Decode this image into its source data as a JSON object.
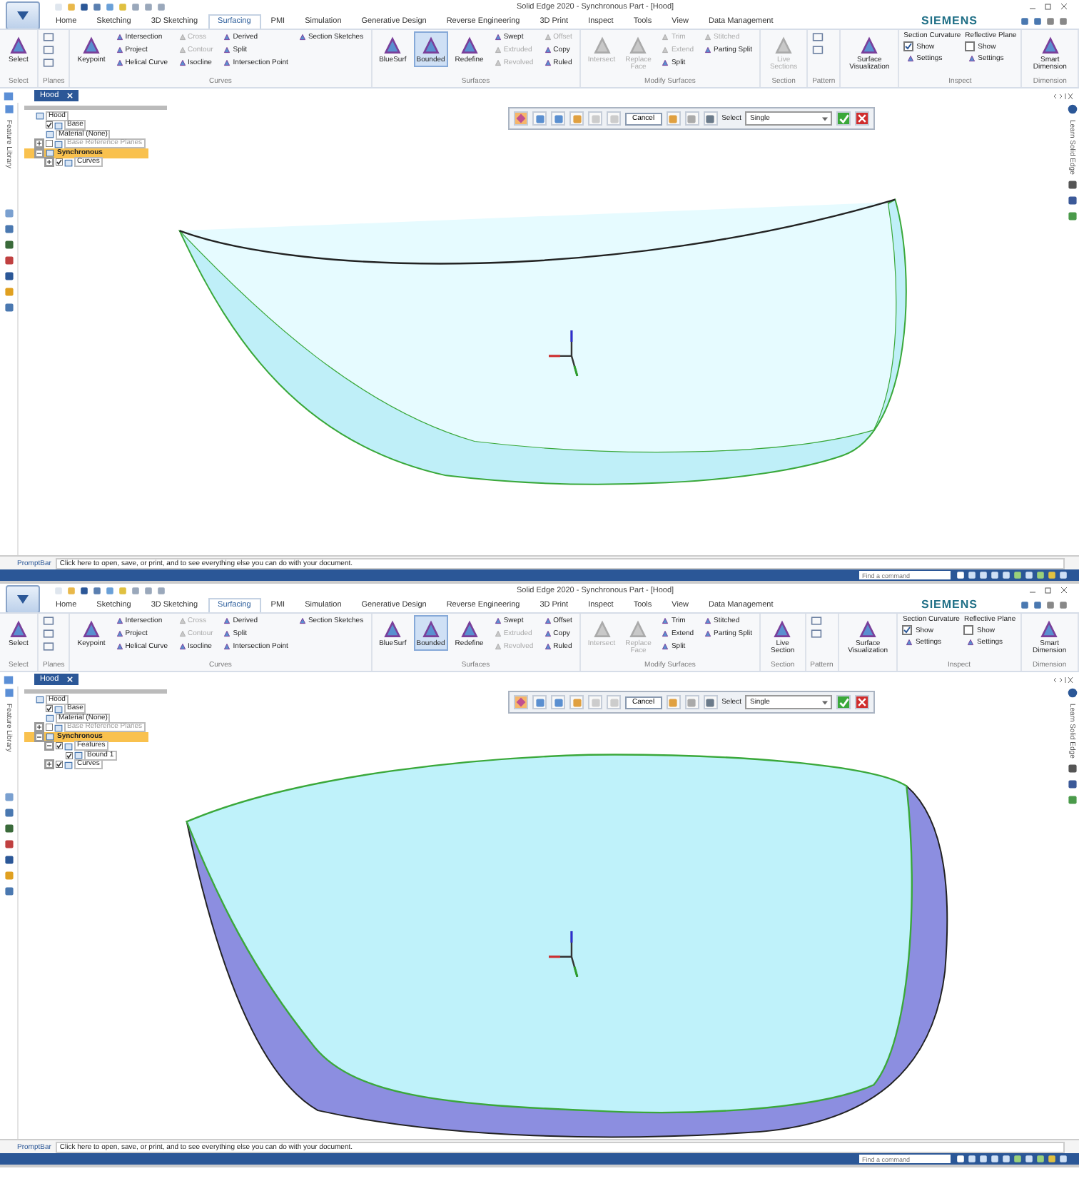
{
  "screens": [
    {
      "window": {
        "title": "Solid Edge 2020 - Synchronous Part - [Hood]",
        "brand": "SIEMENS"
      },
      "ribbon_tabs": [
        {
          "label": "Home",
          "selected": false
        },
        {
          "label": "Sketching",
          "selected": false
        },
        {
          "label": "3D Sketching",
          "selected": false
        },
        {
          "label": "Surfacing",
          "selected": true
        },
        {
          "label": "PMI",
          "selected": false
        },
        {
          "label": "Simulation",
          "selected": false
        },
        {
          "label": "Generative Design",
          "selected": false
        },
        {
          "label": "Reverse Engineering",
          "selected": false
        },
        {
          "label": "3D Print",
          "selected": false
        },
        {
          "label": "Inspect",
          "selected": false
        },
        {
          "label": "Tools",
          "selected": false
        },
        {
          "label": "View",
          "selected": false
        },
        {
          "label": "Data Management",
          "selected": false
        }
      ],
      "ribbon_groups": [
        {
          "label": "Select",
          "columns": [
            [
              {
                "kind": "large",
                "label": "Select",
                "disabled": false,
                "selected": false
              }
            ]
          ]
        },
        {
          "label": "Planes",
          "columns": [
            [
              {
                "kind": "icon",
                "disabled": false,
                "selected": false
              },
              {
                "kind": "icon",
                "disabled": false,
                "selected": false
              },
              {
                "kind": "icon",
                "disabled": false,
                "selected": false
              }
            ]
          ]
        },
        {
          "label": "Curves",
          "columns": [
            [
              {
                "kind": "large",
                "label": "Keypoint",
                "disabled": false,
                "selected": false
              }
            ],
            [
              {
                "kind": "small",
                "label": "Intersection",
                "disabled": false,
                "selected": false
              },
              {
                "kind": "small",
                "label": "Project",
                "disabled": false,
                "selected": false
              },
              {
                "kind": "small",
                "label": "Helical Curve",
                "disabled": false,
                "selected": false
              }
            ],
            [
              {
                "kind": "small",
                "label": "Cross",
                "disabled": true,
                "selected": false
              },
              {
                "kind": "small",
                "label": "Contour",
                "disabled": true,
                "selected": false
              },
              {
                "kind": "small",
                "label": "Isocline",
                "disabled": false,
                "selected": false
              }
            ],
            [
              {
                "kind": "small",
                "label": "Derived",
                "disabled": false,
                "selected": false
              },
              {
                "kind": "small",
                "label": "Split",
                "disabled": false,
                "selected": false
              },
              {
                "kind": "small",
                "label": "Intersection Point",
                "disabled": false,
                "selected": false
              }
            ],
            [
              {
                "kind": "small",
                "label": "Section Sketches",
                "disabled": false,
                "selected": false
              }
            ]
          ]
        },
        {
          "label": "Surfaces",
          "columns": [
            [
              {
                "kind": "large",
                "label": "BlueSurf",
                "disabled": false,
                "selected": false
              }
            ],
            [
              {
                "kind": "large",
                "label": "Bounded",
                "disabled": false,
                "selected": true
              }
            ],
            [
              {
                "kind": "large",
                "label": "Redefine",
                "disabled": false,
                "selected": false
              }
            ],
            [
              {
                "kind": "small",
                "label": "Swept",
                "disabled": false,
                "selected": false
              },
              {
                "kind": "small",
                "label": "Extruded",
                "disabled": true,
                "selected": false
              },
              {
                "kind": "small",
                "label": "Revolved",
                "disabled": true,
                "selected": false
              }
            ],
            [
              {
                "kind": "small",
                "label": "Offset",
                "disabled": true,
                "selected": false
              },
              {
                "kind": "small",
                "label": "Copy",
                "disabled": false,
                "selected": false
              },
              {
                "kind": "small",
                "label": "Ruled",
                "disabled": false,
                "selected": false
              }
            ]
          ]
        },
        {
          "label": "Modify Surfaces",
          "columns": [
            [
              {
                "kind": "large",
                "label": "Intersect",
                "disabled": true,
                "selected": false
              }
            ],
            [
              {
                "kind": "large",
                "label": "Replace Face",
                "disabled": true,
                "selected": false
              }
            ],
            [
              {
                "kind": "small",
                "label": "Trim",
                "disabled": true,
                "selected": false
              },
              {
                "kind": "small",
                "label": "Extend",
                "disabled": true,
                "selected": false
              },
              {
                "kind": "small",
                "label": "Split",
                "disabled": false,
                "selected": false
              }
            ],
            [
              {
                "kind": "small",
                "label": "Stitched",
                "disabled": true,
                "selected": false
              },
              {
                "kind": "small",
                "label": "Parting Split",
                "disabled": false,
                "selected": false
              }
            ]
          ]
        },
        {
          "label": "Section",
          "columns": [
            [
              {
                "kind": "large",
                "label": "Live Sections",
                "disabled": true,
                "selected": false
              }
            ]
          ]
        },
        {
          "label": "Pattern",
          "columns": [
            [
              {
                "kind": "icon",
                "disabled": false,
                "selected": false
              },
              {
                "kind": "icon",
                "disabled": false,
                "selected": false
              }
            ]
          ]
        },
        {
          "columns": [
            [
              {
                "kind": "large",
                "label": "Surface Visualization",
                "disabled": false,
                "selected": false
              }
            ]
          ]
        },
        {
          "label": "Inspect",
          "columns": [
            [
              {
                "kind": "text",
                "label": "Section Curvature",
                "disabled": false,
                "selected": false
              },
              {
                "kind": "checkbox",
                "label": "Show",
                "checked": true,
                "disabled": false,
                "selected": false
              },
              {
                "kind": "small",
                "label": "Settings",
                "disabled": false,
                "selected": false
              }
            ],
            [
              {
                "kind": "text",
                "label": "Reflective Plane",
                "disabled": false,
                "selected": false
              },
              {
                "kind": "checkbox",
                "label": "Show",
                "checked": false,
                "disabled": false,
                "selected": false
              },
              {
                "kind": "small",
                "label": "Settings",
                "disabled": false,
                "selected": false
              }
            ]
          ]
        },
        {
          "label": "Dimension",
          "columns": [
            [
              {
                "kind": "large",
                "label": "Smart Dimension",
                "disabled": false,
                "selected": false
              }
            ]
          ]
        }
      ],
      "document_tab": "Hood",
      "side_tab": "Feature Library",
      "right_side_tab": "Learn Solid Edge",
      "tree": [
        {
          "label": "Hood",
          "children": [
            {
              "label": "Base",
              "checked": true
            },
            {
              "label": "Material (None)"
            },
            {
              "label": "Base Reference Planes",
              "checked": false,
              "expanded": false,
              "disabled": true
            },
            {
              "label": "Synchronous",
              "expanded": true,
              "selected": true,
              "children": [
                {
                  "label": "Curves",
                  "checked": true,
                  "expanded": false
                }
              ]
            }
          ]
        }
      ],
      "command_bar": {
        "cancel": "Cancel",
        "select_label": "Select",
        "select_value": "Single"
      },
      "model": {
        "kind": "open_edge"
      },
      "prompt_bar": {
        "label": "PromptBar",
        "message": "Click here to open, save, or print, and to see everything else you can do with your document."
      },
      "status_bar": {
        "placeholder": "Find a command"
      }
    },
    {
      "window": {
        "title": "Solid Edge 2020 - Synchronous Part - [Hood]",
        "brand": "SIEMENS"
      },
      "ribbon_tabs": [
        {
          "label": "Home",
          "selected": false
        },
        {
          "label": "Sketching",
          "selected": false
        },
        {
          "label": "3D Sketching",
          "selected": false
        },
        {
          "label": "Surfacing",
          "selected": true
        },
        {
          "label": "PMI",
          "selected": false
        },
        {
          "label": "Simulation",
          "selected": false
        },
        {
          "label": "Generative Design",
          "selected": false
        },
        {
          "label": "Reverse Engineering",
          "selected": false
        },
        {
          "label": "3D Print",
          "selected": false
        },
        {
          "label": "Inspect",
          "selected": false
        },
        {
          "label": "Tools",
          "selected": false
        },
        {
          "label": "View",
          "selected": false
        },
        {
          "label": "Data Management",
          "selected": false
        }
      ],
      "ribbon_groups": [
        {
          "label": "Select",
          "columns": [
            [
              {
                "kind": "large",
                "label": "Select",
                "disabled": false,
                "selected": false
              }
            ]
          ]
        },
        {
          "label": "Planes",
          "columns": [
            [
              {
                "kind": "icon",
                "disabled": false,
                "selected": false
              },
              {
                "kind": "icon",
                "disabled": false,
                "selected": false
              },
              {
                "kind": "icon",
                "disabled": false,
                "selected": false
              }
            ]
          ]
        },
        {
          "label": "Curves",
          "columns": [
            [
              {
                "kind": "large",
                "label": "Keypoint",
                "disabled": false,
                "selected": false
              }
            ],
            [
              {
                "kind": "small",
                "label": "Intersection",
                "disabled": false,
                "selected": false
              },
              {
                "kind": "small",
                "label": "Project",
                "disabled": false,
                "selected": false
              },
              {
                "kind": "small",
                "label": "Helical Curve",
                "disabled": false,
                "selected": false
              }
            ],
            [
              {
                "kind": "small",
                "label": "Cross",
                "disabled": true,
                "selected": false
              },
              {
                "kind": "small",
                "label": "Contour",
                "disabled": true,
                "selected": false
              },
              {
                "kind": "small",
                "label": "Isocline",
                "disabled": false,
                "selected": false
              }
            ],
            [
              {
                "kind": "small",
                "label": "Derived",
                "disabled": false,
                "selected": false
              },
              {
                "kind": "small",
                "label": "Split",
                "disabled": false,
                "selected": false
              },
              {
                "kind": "small",
                "label": "Intersection Point",
                "disabled": false,
                "selected": false
              }
            ],
            [
              {
                "kind": "small",
                "label": "Section Sketches",
                "disabled": false,
                "selected": false
              }
            ]
          ]
        },
        {
          "label": "Surfaces",
          "columns": [
            [
              {
                "kind": "large",
                "label": "BlueSurf",
                "disabled": false,
                "selected": false
              }
            ],
            [
              {
                "kind": "large",
                "label": "Bounded",
                "disabled": false,
                "selected": true
              }
            ],
            [
              {
                "kind": "large",
                "label": "Redefine",
                "disabled": false,
                "selected": false
              }
            ],
            [
              {
                "kind": "small",
                "label": "Swept",
                "disabled": false,
                "selected": false
              },
              {
                "kind": "small",
                "label": "Extruded",
                "disabled": true,
                "selected": false
              },
              {
                "kind": "small",
                "label": "Revolved",
                "disabled": true,
                "selected": false
              }
            ],
            [
              {
                "kind": "small",
                "label": "Offset",
                "disabled": false,
                "selected": false
              },
              {
                "kind": "small",
                "label": "Copy",
                "disabled": false,
                "selected": false
              },
              {
                "kind": "small",
                "label": "Ruled",
                "disabled": false,
                "selected": false
              }
            ]
          ]
        },
        {
          "label": "Modify Surfaces",
          "columns": [
            [
              {
                "kind": "large",
                "label": "Intersect",
                "disabled": true,
                "selected": false
              }
            ],
            [
              {
                "kind": "large",
                "label": "Replace Face",
                "disabled": true,
                "selected": false
              }
            ],
            [
              {
                "kind": "small",
                "label": "Trim",
                "disabled": false,
                "selected": false
              },
              {
                "kind": "small",
                "label": "Extend",
                "disabled": false,
                "selected": false
              },
              {
                "kind": "small",
                "label": "Split",
                "disabled": false,
                "selected": false
              }
            ],
            [
              {
                "kind": "small",
                "label": "Stitched",
                "disabled": false,
                "selected": false
              },
              {
                "kind": "small",
                "label": "Parting Split",
                "disabled": false,
                "selected": false
              }
            ]
          ]
        },
        {
          "label": "Section",
          "columns": [
            [
              {
                "kind": "large",
                "label": "Live Section",
                "disabled": false,
                "selected": false
              }
            ]
          ]
        },
        {
          "label": "Pattern",
          "columns": [
            [
              {
                "kind": "icon",
                "disabled": false,
                "selected": false
              },
              {
                "kind": "icon",
                "disabled": false,
                "selected": false
              }
            ]
          ]
        },
        {
          "columns": [
            [
              {
                "kind": "large",
                "label": "Surface Visualization",
                "disabled": false,
                "selected": false
              }
            ]
          ]
        },
        {
          "label": "Inspect",
          "columns": [
            [
              {
                "kind": "text",
                "label": "Section Curvature",
                "disabled": false,
                "selected": false
              },
              {
                "kind": "checkbox",
                "label": "Show",
                "checked": true,
                "disabled": false,
                "selected": false
              },
              {
                "kind": "small",
                "label": "Settings",
                "disabled": false,
                "selected": false
              }
            ],
            [
              {
                "kind": "text",
                "label": "Reflective Plane",
                "disabled": false,
                "selected": false
              },
              {
                "kind": "checkbox",
                "label": "Show",
                "checked": false,
                "disabled": false,
                "selected": false
              },
              {
                "kind": "small",
                "label": "Settings",
                "disabled": false,
                "selected": false
              }
            ]
          ]
        },
        {
          "label": "Dimension",
          "columns": [
            [
              {
                "kind": "large",
                "label": "Smart Dimension",
                "disabled": false,
                "selected": false
              }
            ]
          ]
        }
      ],
      "document_tab": "Hood",
      "side_tab": "Feature Library",
      "right_side_tab": "Learn Solid Edge",
      "tree": [
        {
          "label": "Hood",
          "children": [
            {
              "label": "Base",
              "checked": true
            },
            {
              "label": "Material (None)"
            },
            {
              "label": "Base Reference Planes",
              "checked": false,
              "expanded": false,
              "disabled": true
            },
            {
              "label": "Synchronous",
              "expanded": true,
              "selected": true,
              "children": [
                {
                  "label": "Features",
                  "checked": true,
                  "expanded": true,
                  "children": [
                    {
                      "label": "Bound 1",
                      "checked": true
                    }
                  ]
                },
                {
                  "label": "Curves",
                  "checked": true,
                  "expanded": false
                }
              ]
            }
          ]
        }
      ],
      "command_bar": {
        "cancel": "Cancel",
        "select_label": "Select",
        "select_value": "Single"
      },
      "model": {
        "kind": "bounded_surface"
      },
      "prompt_bar": {
        "label": "PromptBar",
        "message": "Click here to open, save, or print, and to see everything else you can do with your document."
      },
      "status_bar": {
        "placeholder": "Find a command"
      }
    }
  ]
}
